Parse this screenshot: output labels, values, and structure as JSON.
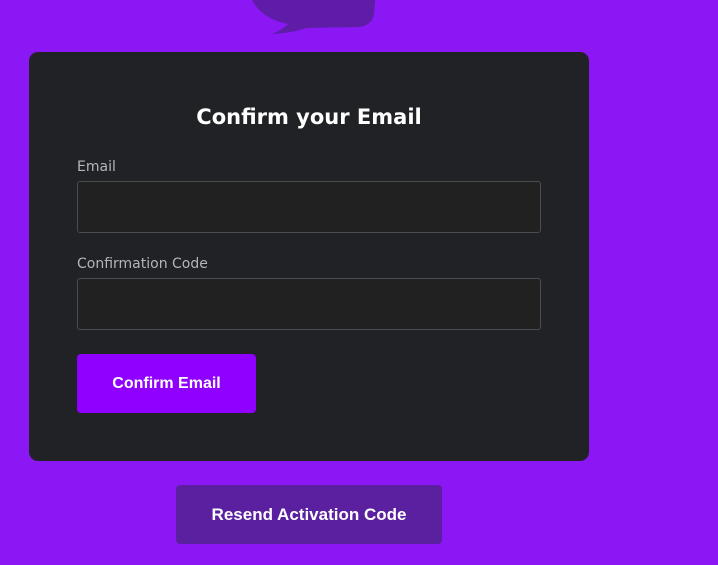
{
  "logo": {
    "icon": "speech-bubble-logo-icon",
    "color": "#5f1ca6"
  },
  "form": {
    "title": "Confirm your Email",
    "email": {
      "label": "Email",
      "value": "",
      "placeholder": ""
    },
    "confirmation_code": {
      "label": "Confirmation Code",
      "value": "",
      "placeholder": ""
    },
    "submit_label": "Confirm Email"
  },
  "resend_label": "Resend Activation Code",
  "colors": {
    "page_background": "#8b17f4",
    "card_background": "#212225",
    "primary_button": "#9000ff",
    "secondary_button": "#5a20a0"
  }
}
